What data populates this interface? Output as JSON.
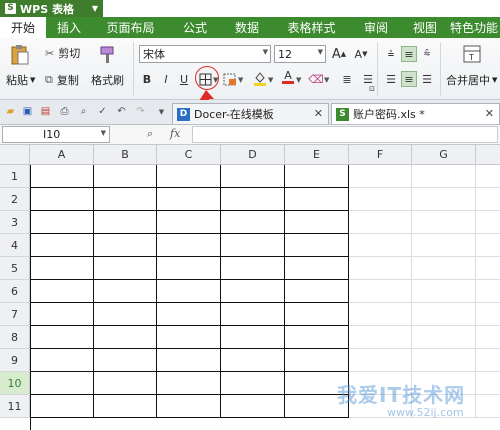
{
  "app": {
    "logo": "S",
    "title": "WPS 表格"
  },
  "menu": [
    "开始",
    "插入",
    "页面布局",
    "公式",
    "数据",
    "表格样式",
    "审阅",
    "视图",
    "特色功能"
  ],
  "ribbon": {
    "paste": "粘贴",
    "cut": "剪切",
    "copy": "复制",
    "format_painter": "格式刷",
    "font_name": "宋体",
    "font_size": "12",
    "bold": "B",
    "italic": "I",
    "underline": "U",
    "merge_center": "合并居中",
    "grow_font": "A",
    "shrink_font": "A",
    "font_color": "A"
  },
  "tabs": [
    {
      "label": "Docer-在线模板",
      "icon": "D",
      "color": "#2b6fc4"
    },
    {
      "label": "账户密码.xls *",
      "icon": "S",
      "color": "#3b8a2e"
    }
  ],
  "formula_bar": {
    "cell_ref": "I10",
    "fx": "fx",
    "value": ""
  },
  "sheet": {
    "columns": [
      "A",
      "B",
      "C",
      "D",
      "E",
      "F",
      "G"
    ],
    "rows": [
      "1",
      "2",
      "3",
      "4",
      "5",
      "6",
      "7",
      "8",
      "9",
      "10",
      "11"
    ],
    "selected_row": "10"
  },
  "watermark": {
    "text": "我爱IT技术网",
    "url": "www.52ij.com"
  },
  "colors": {
    "accent": "#3d8b2f",
    "annotation": "#e02a2a"
  }
}
